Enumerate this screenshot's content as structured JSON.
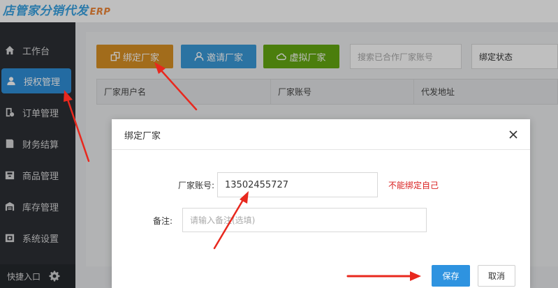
{
  "header": {
    "logo_text": "店管家分销代发",
    "logo_suffix": "ERP"
  },
  "sidebar": {
    "items": [
      {
        "label": "工作台",
        "icon": "home-icon"
      },
      {
        "label": "授权管理",
        "icon": "user-icon",
        "active": true
      },
      {
        "label": "订单管理",
        "icon": "order-icon"
      },
      {
        "label": "财务结算",
        "icon": "finance-icon"
      },
      {
        "label": "商品管理",
        "icon": "product-icon"
      },
      {
        "label": "库存管理",
        "icon": "warehouse-icon"
      },
      {
        "label": "系统设置",
        "icon": "settings-icon"
      }
    ],
    "quick_entry_label": "快捷入口"
  },
  "toolbar": {
    "bind_label": "绑定厂家",
    "invite_label": "邀请厂家",
    "virtual_label": "虚拟厂家",
    "search_placeholder": "搜索已合作厂家账号",
    "status_select_value": "绑定状态"
  },
  "table": {
    "columns": [
      "厂家用户名",
      "厂家账号",
      "代发地址"
    ]
  },
  "modal": {
    "title": "绑定厂家",
    "account_label": "厂家账号:",
    "account_value": "13502455727",
    "error_message": "不能绑定自己",
    "remark_label": "备注:",
    "remark_placeholder": "请输入备注(选填)",
    "save_label": "保存",
    "cancel_label": "取消"
  },
  "colors": {
    "sidebar_bg": "#2c2f34",
    "active_blue": "#2f8fd8",
    "bind_orange": "#d99024",
    "invite_blue": "#3a9ad8",
    "virtual_green": "#64a812",
    "error_red": "#d9201f",
    "arrow_red": "#e8281e"
  }
}
